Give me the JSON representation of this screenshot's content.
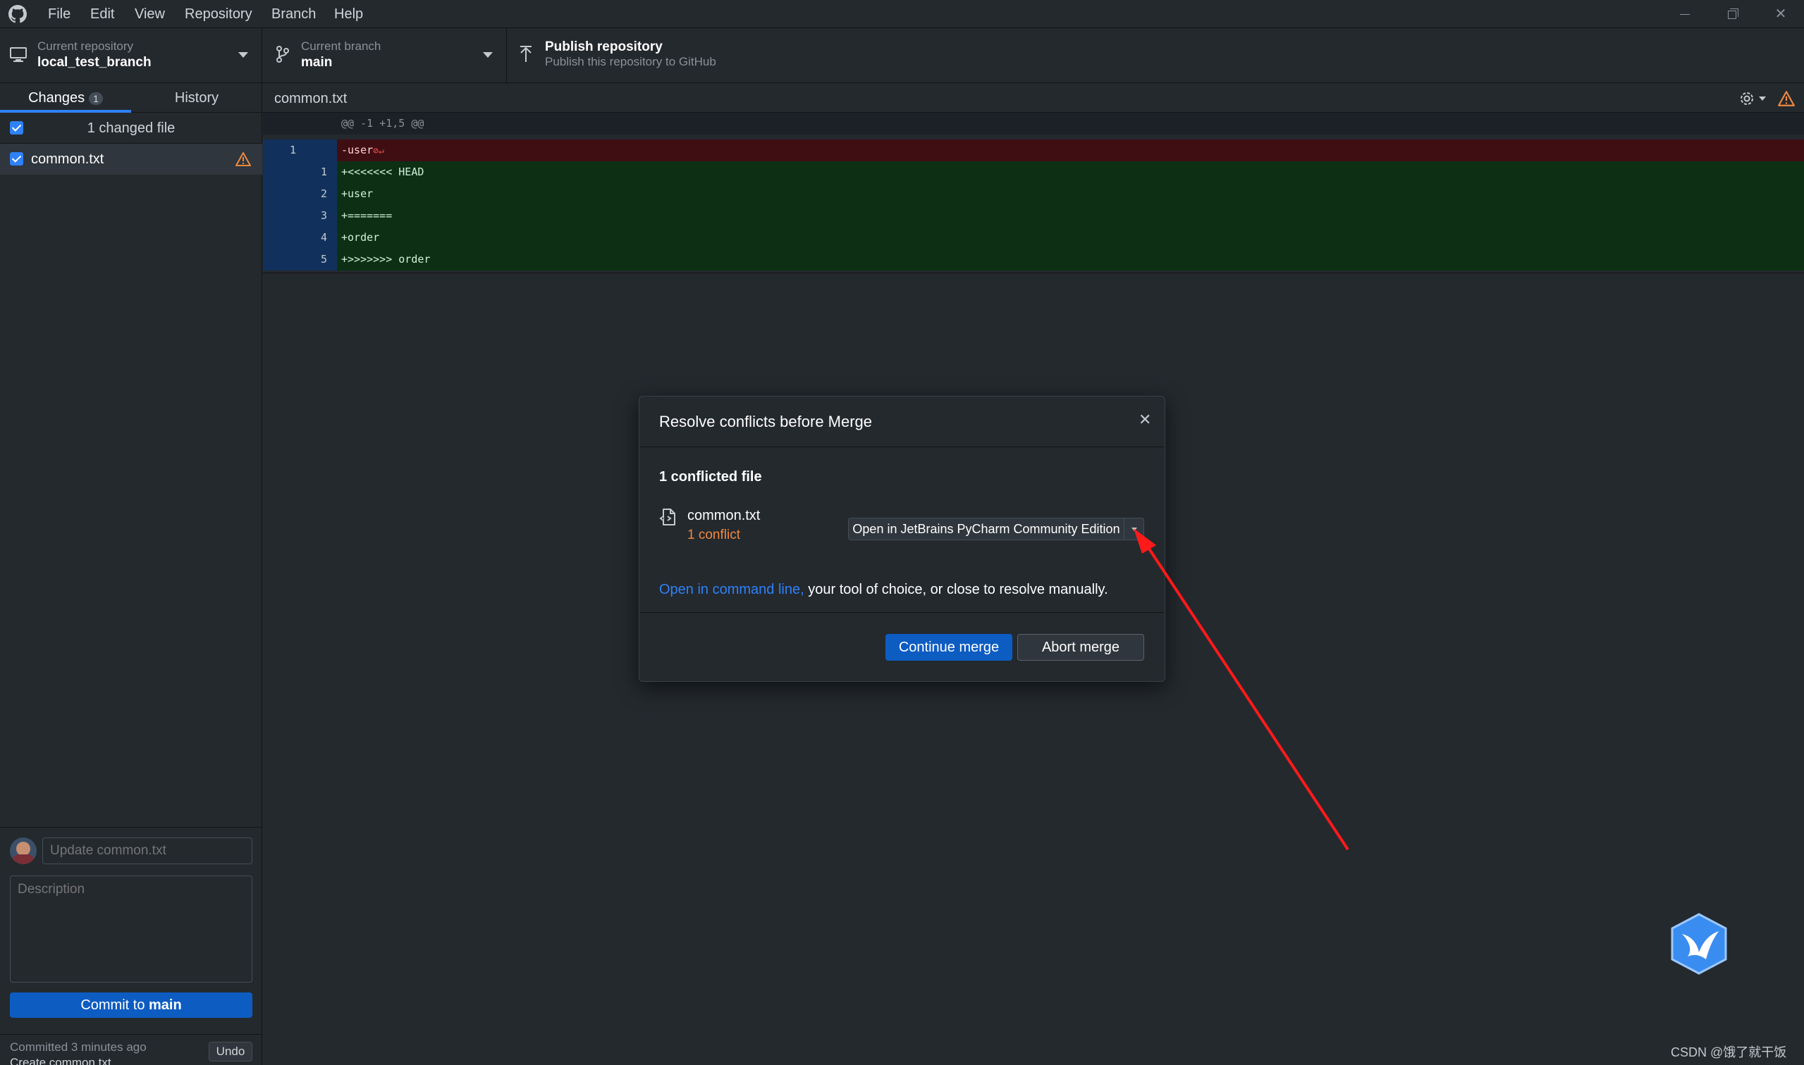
{
  "menu": [
    "File",
    "Edit",
    "View",
    "Repository",
    "Branch",
    "Help"
  ],
  "toolbar": {
    "repo_label": "Current repository",
    "repo_name": "local_test_branch",
    "branch_label": "Current branch",
    "branch_name": "main",
    "publish_title": "Publish repository",
    "publish_sub": "Publish this repository to GitHub"
  },
  "sidebar": {
    "tab_changes": "Changes",
    "changes_count": "1",
    "tab_history": "History",
    "changed_files_label": "1 changed file",
    "files": [
      {
        "name": "common.txt",
        "status": "conflict"
      }
    ]
  },
  "diff": {
    "filename": "common.txt",
    "hunk_header": "@@ -1 +1,5 @@",
    "lines": [
      {
        "old": "1",
        "new": "",
        "type": "removed",
        "text": "-user"
      },
      {
        "old": "",
        "new": "1",
        "type": "added",
        "text": "+<<<<<<< HEAD"
      },
      {
        "old": "",
        "new": "2",
        "type": "added",
        "text": "+user"
      },
      {
        "old": "",
        "new": "3",
        "type": "added",
        "text": "+======="
      },
      {
        "old": "",
        "new": "4",
        "type": "added",
        "text": "+order"
      },
      {
        "old": "",
        "new": "5",
        "type": "added",
        "text": "+>>>>>>> order"
      }
    ],
    "no_newline_marker": "⊘↵"
  },
  "dialog": {
    "title": "Resolve conflicts before Merge",
    "conflicted_heading": "1 conflicted file",
    "file_name": "common.txt",
    "conflict_text": "1 conflict",
    "open_button": "Open in JetBrains PyCharm Community Edition",
    "cmd_link": "Open in command line,",
    "cmd_rest": " your tool of choice, or close to resolve manually.",
    "continue_button": "Continue merge",
    "abort_button": "Abort merge"
  },
  "commit": {
    "summary_placeholder": "Update common.txt",
    "description_placeholder": "Description",
    "button_prefix": "Commit to ",
    "button_branch": "main"
  },
  "last_commit": {
    "text": "Committed 3 minutes ago",
    "message": "Create common.txt",
    "undo": "Undo"
  },
  "watermark": "CSDN @饿了就干饭",
  "colors": {
    "accent": "#2f81f7",
    "removed_bg": "#3f0e13",
    "added_bg": "#0d3015",
    "conflict_orange": "#f0883e",
    "annotation_arrow": "#ff1a1a"
  }
}
